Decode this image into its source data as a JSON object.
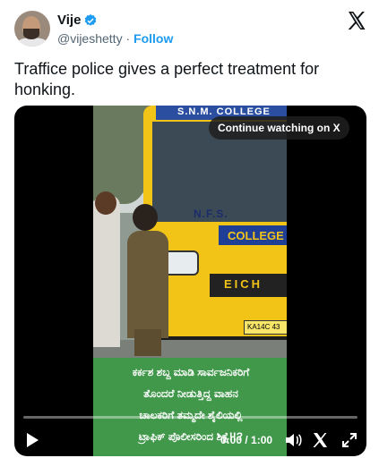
{
  "author": {
    "display_name": "Vije",
    "handle": "@vijeshetty",
    "separator": "·",
    "follow_label": "Follow"
  },
  "tweet": {
    "text": "Traffice police gives a perfect treatment for honking."
  },
  "video": {
    "overlay_button": "Continue watching on X",
    "bus_header": "S.N.M. COLLEGE",
    "bus_nfs": "N.F.S.",
    "bus_college": "COLLEGE",
    "bus_grille": "EICH",
    "plate": "KA14C 43",
    "caption_lines": [
      "ಕರ್ಕಶ ಶಬ್ದ ಮಾಡಿ ಸಾರ್ವಜನಿಕರಿಗೆ",
      "ತೊಂದರೆ ನೀಡುತ್ತಿದ್ದ ವಾಹನ",
      "ಚಾಲಕರಿಗೆ ತಮ್ಮದೇ ಶೈಲಿಯಲ್ಲಿ",
      "ಟ್ರಾಫಿಕ್ ಪೊಲೀಸರಿಂದ ಶಿಕ್ಷೆ!!?"
    ],
    "time": "0:00 / 1:00",
    "progress_fraction": 0.0
  },
  "colors": {
    "accent": "#1d9bf0",
    "caption_bg": "#3c9a46",
    "bus_yellow": "#f2c418"
  },
  "icons": [
    "verified-badge-icon",
    "x-logo-icon",
    "play-icon",
    "volume-icon",
    "close-x-icon",
    "fullscreen-icon"
  ]
}
